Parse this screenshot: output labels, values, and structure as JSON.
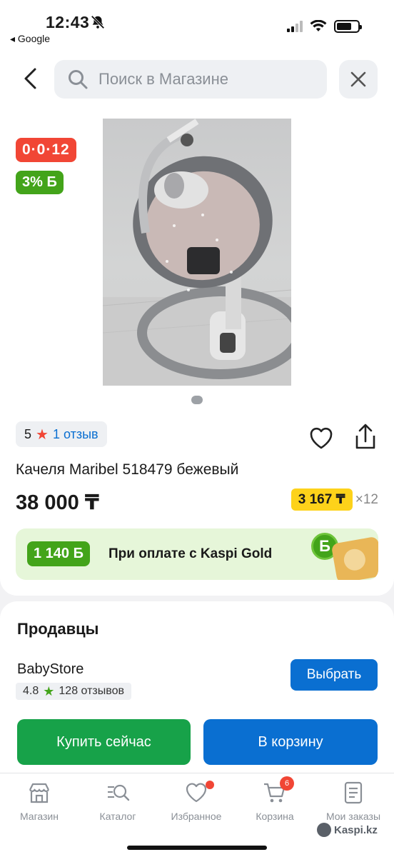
{
  "status": {
    "time": "12:43",
    "back_app": "◂ Google"
  },
  "search": {
    "placeholder": "Поиск в Магазине"
  },
  "product": {
    "installment_badge": "0·0·12",
    "bonus_badge": "3% Б",
    "rating": "5",
    "reviews": "1 отзыв",
    "title": "Качеля Maribel 518479 бежевый",
    "price": "38 000 ₸",
    "monthly_price": "3 167 ₸",
    "monthly_months": "×12",
    "gold_bonus": "1 140 Б",
    "gold_text": "При оплате с Kaspi Gold",
    "gold_coin": "Б"
  },
  "sellers": {
    "title": "Продавцы",
    "name": "BabyStore",
    "rating": "4.8",
    "reviews": "128 отзывов",
    "choose_label": "Выбрать",
    "buy_now_label": "Купить сейчас",
    "to_cart_label": "В корзину"
  },
  "tabbar": {
    "items": [
      {
        "label": "Магазин",
        "icon": "store-icon"
      },
      {
        "label": "Каталог",
        "icon": "catalog-search-icon"
      },
      {
        "label": "Избранное",
        "icon": "heart-icon"
      },
      {
        "label": "Корзина",
        "icon": "cart-icon",
        "badge": "6"
      },
      {
        "label": "Мои заказы",
        "icon": "orders-icon"
      }
    ]
  },
  "watermark": "Kaspi.kz",
  "colors": {
    "kaspi_red": "#f14635",
    "green": "#43a41a",
    "blue": "#0a6fd1",
    "yellow": "#fdd21a"
  }
}
